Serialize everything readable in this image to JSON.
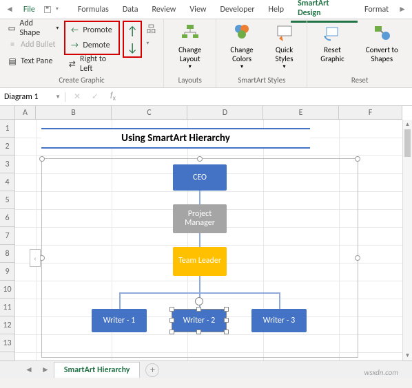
{
  "titlebar": {
    "file": "File",
    "tabs": [
      "Formulas",
      "Data",
      "Review",
      "View",
      "Developer",
      "Help",
      "SmartArt Design",
      "Format"
    ],
    "active_tab": "SmartArt Design"
  },
  "ribbon": {
    "create_graphic": {
      "label": "Create Graphic",
      "add_shape": "Add Shape",
      "add_bullet": "Add Bullet",
      "text_pane": "Text Pane",
      "promote": "Promote",
      "demote": "Demote",
      "right_to_left": "Right to Left"
    },
    "layouts": {
      "label": "Layouts",
      "change_layout": "Change Layout"
    },
    "smartart_styles": {
      "label": "SmartArt Styles",
      "change_colors": "Change Colors",
      "quick_styles": "Quick Styles"
    },
    "reset": {
      "label": "Reset",
      "reset_graphic": "Reset Graphic",
      "convert_to_shapes": "Convert to Shapes"
    }
  },
  "name_box": "Diagram 1",
  "content": {
    "title": "Using SmartArt Hierarchy",
    "nodes": {
      "ceo": "CEO",
      "pm": "Project Manager",
      "tl": "Team Leader",
      "w1": "Writer - 1",
      "w2": "Writer - 2",
      "w3": "Writer - 3"
    }
  },
  "columns": [
    "A",
    "B",
    "C",
    "D",
    "E",
    "F"
  ],
  "rows": [
    "1",
    "2",
    "3",
    "4",
    "5",
    "6",
    "7",
    "8",
    "9",
    "10",
    "11",
    "12",
    "13"
  ],
  "sheet_tab": "SmartArt Hierarchy",
  "watermark": "wsxdn.com"
}
